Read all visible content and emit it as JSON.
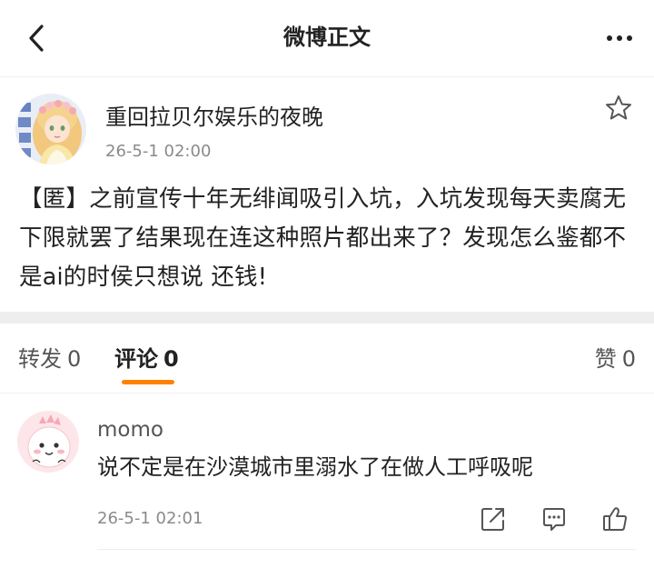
{
  "nav": {
    "title": "微博正文",
    "back_icon": "back-chevron-icon",
    "more_icon": "more-dots-icon"
  },
  "post": {
    "author": "重回拉贝尔娱乐的夜晚",
    "time": "26-5-1 02:00",
    "avatar_icon": "anime-girl-avatar",
    "text": "【匿】之前宣传十年无绯闻吸引入坑，入坑发现每天卖腐无下限就罢了结果现在连这种照片都出来了？发现怎么鉴都不是ai的时侯只想说  还钱!"
  },
  "tabs": {
    "repost": {
      "label": "转发",
      "count": "0"
    },
    "comments": {
      "label": "评论",
      "count": "0"
    },
    "likes": {
      "label": "赞",
      "count": "0"
    },
    "active": "comments"
  },
  "comment": {
    "author": "momo",
    "text": "说不定是在沙漠城市里溺水了在做人工呼吸呢",
    "time": "26-5-1 02:01",
    "avatar_icon": "pink-dinosaur-avatar"
  },
  "colors": {
    "accent": "#ff8200",
    "text_primary": "#222222",
    "text_secondary": "#8a8a8a",
    "separator": "#eeeeee"
  }
}
